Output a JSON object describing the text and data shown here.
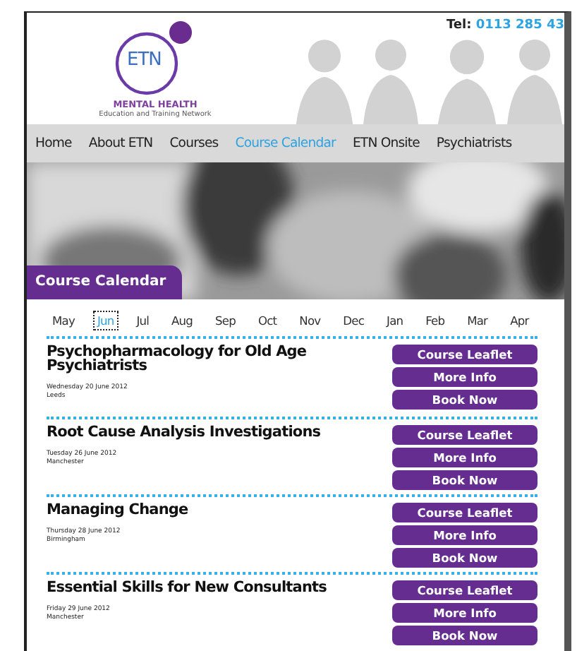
{
  "header": {
    "logo": {
      "initials": "ETN",
      "name": "MENTAL HEALTH",
      "tagline": "Education and Training Network"
    },
    "phone": {
      "label": "Tel:",
      "number": "0113 285 43"
    }
  },
  "nav": [
    {
      "label": "Home",
      "selected": false
    },
    {
      "label": "About ETN",
      "selected": false
    },
    {
      "label": "Courses",
      "selected": false
    },
    {
      "label": "Course Calendar",
      "selected": true
    },
    {
      "label": "ETN Onsite",
      "selected": false
    },
    {
      "label": "Psychiatrists",
      "selected": false
    }
  ],
  "section_tab": "Course Calendar",
  "months": [
    {
      "label": "May",
      "selected": false
    },
    {
      "label": "Jun",
      "selected": true
    },
    {
      "label": "Jul",
      "selected": false
    },
    {
      "label": "Aug",
      "selected": false
    },
    {
      "label": "Sep",
      "selected": false
    },
    {
      "label": "Oct",
      "selected": false
    },
    {
      "label": "Nov",
      "selected": false
    },
    {
      "label": "Dec",
      "selected": false
    },
    {
      "label": "Jan",
      "selected": false
    },
    {
      "label": "Feb",
      "selected": false
    },
    {
      "label": "Mar",
      "selected": false
    },
    {
      "label": "Apr",
      "selected": false
    }
  ],
  "courses": [
    {
      "title": "Psychopharmacology for Old Age Psychiatrists",
      "date": "Wednesday 20 June 2012",
      "location": "Leeds",
      "buttons": [
        "Course Leaflet",
        "More Info",
        "Book Now"
      ]
    },
    {
      "title": "Root Cause Analysis Investigations",
      "date": "Tuesday 26 June 2012",
      "location": "Manchester",
      "buttons": [
        "Course Leaflet",
        "More Info",
        "Book Now"
      ]
    },
    {
      "title": "Managing Change",
      "date": "Thursday 28 June 2012",
      "location": "Birmingham",
      "buttons": [
        "Course Leaflet",
        "More Info",
        "Book Now"
      ]
    },
    {
      "title": "Essential Skills for New Consultants",
      "date": "Friday 29 June 2012",
      "location": "Manchester",
      "buttons": [
        "Course Leaflet",
        "More Info",
        "Book Now"
      ]
    }
  ]
}
